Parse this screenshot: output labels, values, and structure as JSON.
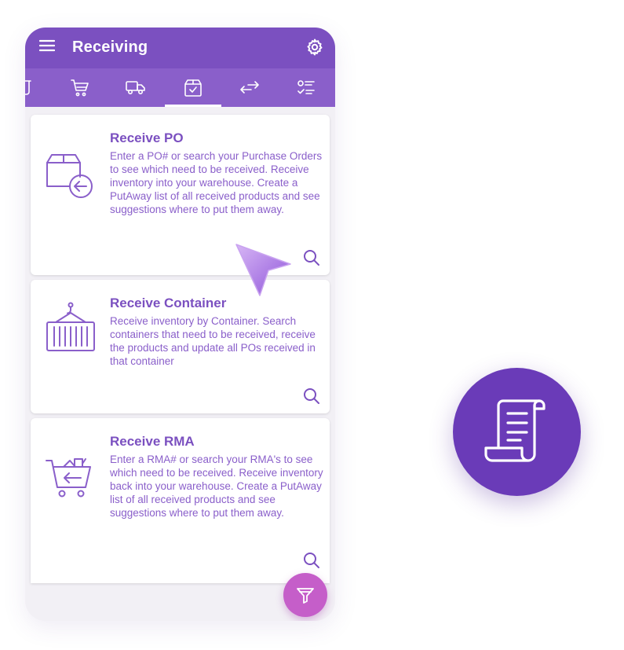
{
  "appbar": {
    "title": "Receiving",
    "menu_icon": "hamburger-menu-icon",
    "settings_icon": "gear-icon"
  },
  "tabs": [
    {
      "icon": "partial-icon",
      "active": false
    },
    {
      "icon": "shopping-cart-icon",
      "active": false
    },
    {
      "icon": "delivery-truck-icon",
      "active": false
    },
    {
      "icon": "box-check-icon",
      "active": true
    },
    {
      "icon": "transfer-arrows-icon",
      "active": false
    },
    {
      "icon": "checklist-icon",
      "active": false
    }
  ],
  "cards": [
    {
      "title": "Receive PO",
      "description": "Enter a PO# or search your Purchase Orders to see which need to be received. Receive inventory into your warehouse. Create a PutAway list of all received products and see suggestions where to put them away.",
      "icon": "box-arrow-in-icon"
    },
    {
      "title": "Receive Container",
      "description": "Receive inventory by Container. Search containers that need to be received, receive the products and update all POs received in that container",
      "icon": "shipping-container-icon"
    },
    {
      "title": "Receive RMA",
      "description": "Enter a RMA# or search your RMA's to see which need to be received. Receive inventory back into your warehouse. Create a PutAway list of all received products and see suggestions where to put them away.",
      "icon": "cart-return-icon"
    }
  ],
  "fab": {
    "icon": "filter-icon"
  },
  "badge": {
    "icon": "receipt-scroll-icon"
  },
  "colors": {
    "primary": "#7b50c0",
    "tab_bar": "#8a5fca",
    "accent": "#c55ec9",
    "badge": "#6a3bb8"
  }
}
